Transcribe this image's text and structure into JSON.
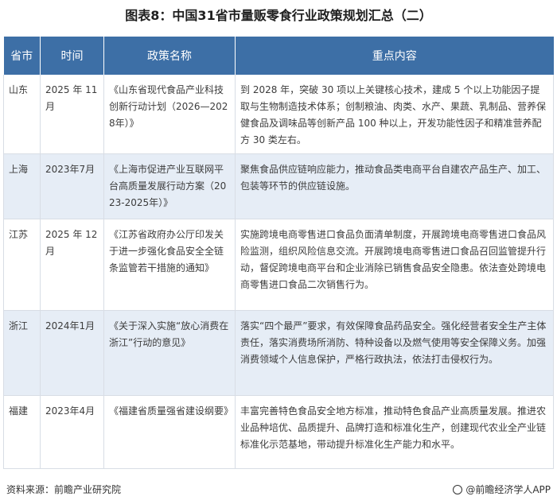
{
  "title": "图表8：中国31省市量贩零食行业政策规划汇总（二）",
  "table": {
    "headers": [
      "省市",
      "时间",
      "政策名称",
      "重点内容"
    ],
    "rows": [
      {
        "province": "山东",
        "time": "2025 年 11月",
        "name": "《山东省现代食品产业科技创新行动计划（2026—2028年）》",
        "content": "到 2028 年，突破 30 项以上关键核心技术，建成 5 个以上功能因子提取与生物制造技术体系；创制粮油、肉类、水产、果蔬、乳制品、营养保健食品及调味品等创新产品 100 种以上，开发功能性因子和精准营养配方 30 类左右。"
      },
      {
        "province": "上海",
        "time": "2023年7月",
        "name": "《上海市促进产业互联网平台高质量发展行动方案（2023-2025年）》",
        "content": "聚焦食品供应链响应能力，推动食品类电商平台自建农产品生产、加工、包装等环节的供应链设施。"
      },
      {
        "province": "江苏",
        "time": "2025 年 12月",
        "name": "《江苏省政府办公厅印发关于进一步强化食品安全全链条监管若干措施的通知》",
        "content": "实施跨境电商零售进口食品负面清单制度，开展跨境电商零售进口食品风险监测，组织风险信息交流。开展跨境电商零售进口食品召回监管提升行动，督促跨境电商平台和企业消除已销售食品安全隐患。依法查处跨境电商零售进口食品二次销售行为。"
      },
      {
        "province": "浙江",
        "time": "2024年1月",
        "name": "《关于深入实施“放心消费在浙江”行动的意见》",
        "content": "落实“四个最严”要求，有效保障食品药品安全。强化经营者安全生产主体责任，落实消费场所消防、特种设备以及燃气使用等安全保障义务。加强消费领域个人信息保护，严格行政执法，依法打击侵权行为。"
      },
      {
        "province": "福建",
        "time": "2023年4月",
        "name": "《福建省质量强省建设纲要》",
        "content": "丰富完善特色食品安全地方标准，推动特色食品产业高质量发展。推进农业品种培优、品质提升、品牌打造和标准化生产，创建现代农业全产业链标准化示范基地，带动提升标准化生产能力和水平。"
      }
    ]
  },
  "footer": {
    "source": "资料来源：前瞻产业研究院",
    "brand": "@前瞻经济学人APP",
    "brand_icon": "eye-logo-icon"
  },
  "colors": {
    "header_bg": "#3d6fa6",
    "alt_row_bg": "#e6edf6"
  }
}
